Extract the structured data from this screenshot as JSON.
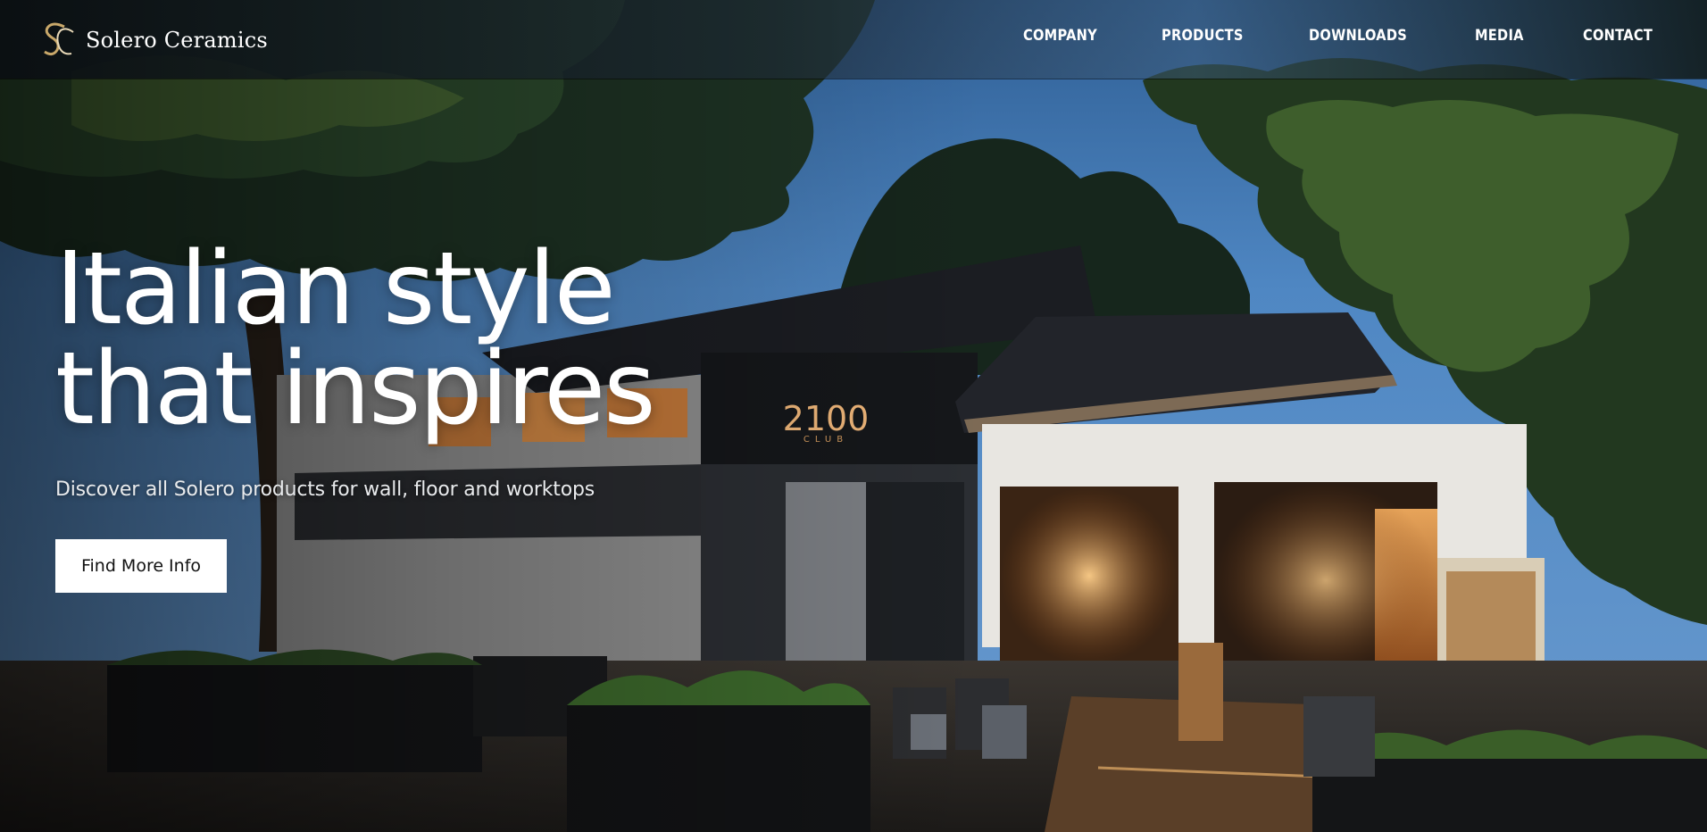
{
  "brand": {
    "name": "Solero Ceramics",
    "logo_letters": "SC",
    "accent_color": "#c9a86a"
  },
  "nav": {
    "items": [
      {
        "label": "COMPANY"
      },
      {
        "label": "PRODUCTS"
      },
      {
        "label": "DOWNLOADS"
      },
      {
        "label": "MEDIA"
      },
      {
        "label": "CONTACT"
      }
    ]
  },
  "hero": {
    "headline_line1": "Italian style",
    "headline_line2": "that inspires",
    "subline": "Discover all Solero products for wall, floor and worktops",
    "cta_label": "Find More Info",
    "image_description_icon": "night-restaurant-photo",
    "sign_text": "2100",
    "sign_subtext": "CLUB"
  }
}
